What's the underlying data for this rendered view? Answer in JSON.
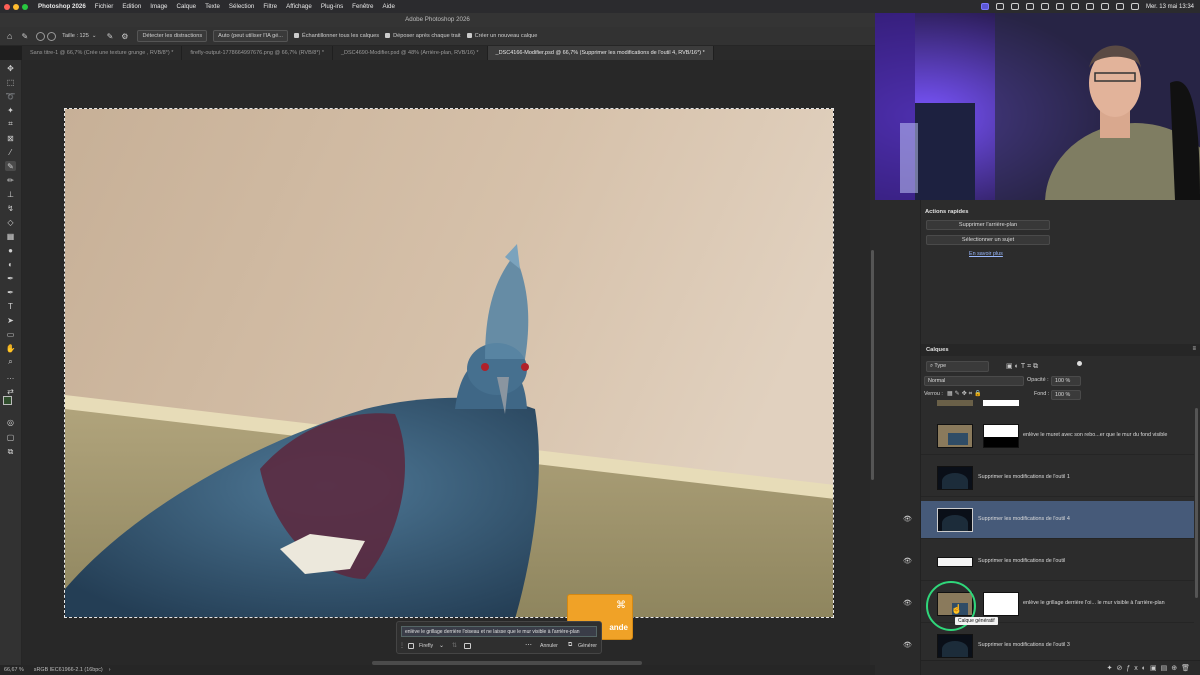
{
  "menubar": {
    "app": "Photoshop 2026",
    "items": [
      "Fichier",
      "Edition",
      "Image",
      "Calque",
      "Texte",
      "Sélection",
      "Filtre",
      "Affichage",
      "Plug-ins",
      "Fenêtre",
      "Aide"
    ],
    "clock": "Mer. 13 mai  13:34"
  },
  "window": {
    "title": "Adobe Photoshop 2026"
  },
  "options": {
    "size_label": "Taille : 125",
    "detect_button": "Détecter les distractions",
    "auto_dropdown": "Auto (peut utiliser l'IA gé...",
    "sample_all": "Échantillonner tous les calques",
    "drop_after": "Déposer après chaque trait",
    "new_layer": "Créer un nouveau calque"
  },
  "tabs": [
    "Sans titre-1 @ 66,7% (Crée une texture grunge      , RVB/8*) *",
    "firefly-output-1778664997676.png @ 66,7% (RVB/8*) *",
    "_DSC4690-Modifier.psd @ 48% (Arrière-plan, RVB/16) *",
    "_DSC4166-Modifier.psd @ 66,7% (Supprimer les modifications de l'outil 4, RVB/16*) *"
  ],
  "status": {
    "zoom": "66,67 %",
    "profile": "sRGB IEC61966-2.1 (16bpc)"
  },
  "quick_actions": {
    "title": "Actions rapides",
    "remove_bg": "Supprimer l'arrière-plan",
    "select_subject": "Sélectionner un sujet",
    "learn_more": "En savoir plus"
  },
  "layers_panel": {
    "title": "Calques",
    "filter": "Type",
    "blend": "Normal",
    "opacity_label": "Opacité :",
    "opacity": "100 %",
    "lock_label": "Verrou :",
    "fill_label": "Fond :",
    "fill": "100 %",
    "layers": [
      {
        "name": "enlève le muret avec son rebo...er que le mur du fond visible",
        "visible": false,
        "selected": false
      },
      {
        "name": "Supprimer les modifications de l'outil 1",
        "visible": false,
        "selected": false
      },
      {
        "name": "Supprimer les modifications de l'outil 4",
        "visible": true,
        "selected": true
      },
      {
        "name": "Supprimer les modifications de l'outil",
        "visible": true,
        "selected": false
      },
      {
        "name": "enlève le grillage derrière l'oi...  le mur visible à l'arrière-plan",
        "visible": true,
        "selected": false
      },
      {
        "name": "Supprimer les modifications de l'outil 3",
        "visible": true,
        "selected": false
      }
    ],
    "tooltip": "Calque génératif"
  },
  "contextual_bar": {
    "prompt": "enlève le grillage derrière l'oiseau et ne laisse que le mur visible à l'arrière-plan",
    "model": "Firefly",
    "cancel": "Annuler",
    "generate": "Générer"
  },
  "orange_box": {
    "text": "ande",
    "icon": "command-icon"
  },
  "colors": {
    "accent": "#465a79",
    "orange": "#f0a227",
    "webcam_glow": "#5b3fd6",
    "highlight_ring": "#2fd67a"
  }
}
